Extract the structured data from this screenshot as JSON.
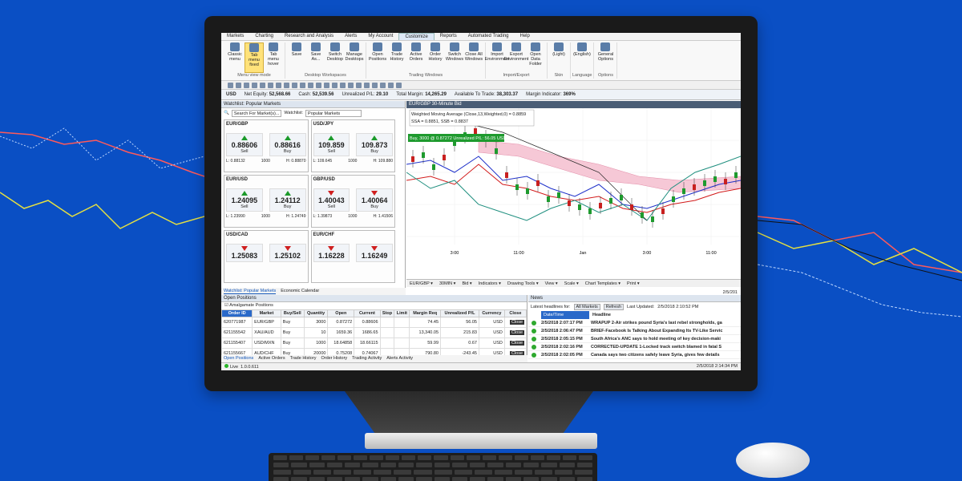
{
  "menu": [
    "Markets",
    "Charting",
    "Research and Analysis",
    "Alerts",
    "My Account",
    "Customize",
    "Reports",
    "Automated Trading",
    "Help"
  ],
  "menu_active": "Customize",
  "ribbon": {
    "groups": [
      {
        "label": "Menu view mode",
        "buttons": [
          "Classic menu",
          "Tab menu fixed",
          "Tab menu hover"
        ],
        "selected": "Tab menu fixed"
      },
      {
        "label": "Desktop Workspaces",
        "buttons": [
          "Save",
          "Save As...",
          "Switch Desktop",
          "Manage Desktops"
        ]
      },
      {
        "label": "Trading Windows",
        "buttons": [
          "Open Positions",
          "Trade History",
          "Active Orders",
          "Order History",
          "Switch Windows",
          "Close All Windows"
        ]
      },
      {
        "label": "Import/Export",
        "buttons": [
          "Import Environment",
          "Export Environment",
          "Open Data Folder"
        ]
      },
      {
        "label": "Skin",
        "buttons": [
          "(Light)"
        ]
      },
      {
        "label": "Language",
        "buttons": [
          "(English)"
        ]
      },
      {
        "label": "Options",
        "buttons": [
          "General Options"
        ]
      }
    ]
  },
  "account": {
    "currency": "USD",
    "net_equity_label": "Net Equity:",
    "net_equity": "52,568.66",
    "cash_label": "Cash:",
    "cash": "52,539.56",
    "upl_label": "Unrealized P/L:",
    "upl": "29.10",
    "margin_label": "Total Margin:",
    "margin": "14,265.29",
    "avail_label": "Available To Trade:",
    "avail": "38,303.37",
    "mi_label": "Margin Indicator:",
    "mi": "369%"
  },
  "watchlist": {
    "title": "Watchlist: Popular Markets",
    "search": "Search For Market(s)...",
    "select_label": "Watchlist:",
    "select_value": "Popular Markets",
    "tiles": [
      {
        "name": "EUR/GBP",
        "sell": "0.88606",
        "buy": "0.88616",
        "spread": "1",
        "sell_dir": "up",
        "buy_dir": "up",
        "low": "L: 0.88132",
        "qty": "1000",
        "high": "H: 0.88870",
        "sell_label": "Sell",
        "buy_label": "Buy"
      },
      {
        "name": "USD/JPY",
        "sell": "109.859",
        "buy": "109.873",
        "spread": "1.4",
        "sell_dir": "up",
        "buy_dir": "up",
        "low": "L: 109.645",
        "qty": "1000",
        "high": "H: 109.880",
        "sell_label": "Sell",
        "buy_label": "Buy"
      },
      {
        "name": "EUR/USD",
        "sell": "1.24095",
        "buy": "1.24112",
        "spread": "1.7",
        "sell_dir": "up",
        "buy_dir": "up",
        "low": "L: 1.23990",
        "qty": "1000",
        "high": "H: 1.24749",
        "sell_label": "Sell",
        "buy_label": "Buy"
      },
      {
        "name": "GBP/USD",
        "sell": "1.40043",
        "buy": "1.40064",
        "spread": "2.1",
        "sell_dir": "dn",
        "buy_dir": "dn",
        "low": "L: 1.39873",
        "qty": "1000",
        "high": "H: 1.41506",
        "sell_label": "Sell",
        "buy_label": "Buy"
      },
      {
        "name": "USD/CAD",
        "sell": "1.25083",
        "buy": "1.25102",
        "spread": "",
        "sell_dir": "dn",
        "buy_dir": "dn",
        "low": "",
        "qty": "",
        "high": "",
        "sell_label": "",
        "buy_label": ""
      },
      {
        "name": "EUR/CHF",
        "sell": "1.16228",
        "buy": "1.16249",
        "spread": "",
        "sell_dir": "dn",
        "buy_dir": "dn",
        "low": "",
        "qty": "",
        "high": "",
        "sell_label": "",
        "buy_label": ""
      }
    ],
    "tabs": [
      "Watchlist: Popular Markets",
      "Economic Calendar"
    ]
  },
  "chart": {
    "title": "EUR/GBP 30-Minute Bid",
    "legend1": "Weighted Moving Average (Close,13,Weighted,0) = 0.8859",
    "legend2": "SSA = 0.8851, SSB = 0.8837",
    "position": "Buy, 3000 @ 0.87272 Unrealized P/L: 56.05 USD",
    "x_ticks": [
      "3:00",
      "11:00",
      "Jan",
      "3:00",
      "11:00"
    ],
    "toolbar": [
      "EUR/GBP",
      "30MIN",
      "Bid",
      "Indicators",
      "Drawing Tools",
      "View",
      "Scale",
      "Chart Templates",
      "Print"
    ],
    "date": "2/5/201"
  },
  "positions": {
    "title": "Open Positions",
    "amalgamate": "Amalgamate Positions",
    "headers": [
      "Order ID",
      "Market",
      "Buy/Sell",
      "Quantity",
      "Open",
      "Current",
      "Stop",
      "Limit",
      "Margin Req",
      "Unrealized P/L",
      "Currency",
      "Close"
    ],
    "rows": [
      [
        "620771987",
        "EUR/GBP",
        "Buy",
        "3000",
        "0.87272",
        "0.88606",
        "",
        "",
        "74.45",
        "56.05",
        "USD",
        "Close"
      ],
      [
        "621155542",
        "XAU/AUD",
        "Buy",
        "10",
        "1659.36",
        "1686.65",
        "",
        "",
        "13,340.05",
        "215.83",
        "USD",
        "Close"
      ],
      [
        "621155407",
        "USD/MXN",
        "Buy",
        "1000",
        "18.64858",
        "18.66115",
        "",
        "",
        "59.99",
        "0.67",
        "USD",
        "Close"
      ],
      [
        "621155667",
        "AUD/CHF",
        "Buy",
        "20000",
        "0.75208",
        "0.74067",
        "",
        "",
        "790.80",
        "-243.45",
        "USD",
        "Close"
      ]
    ],
    "tabs": [
      "Open Positions",
      "Active Orders",
      "Trade History",
      "Order History",
      "Trading Activity",
      "Alerts Activity"
    ]
  },
  "news": {
    "title": "News",
    "latest_label": "Latest headlines for:",
    "filter": "All Markets",
    "refresh": "Refresh",
    "updated_label": "Last Updated:",
    "updated": "2/5/2018 2:10:52 PM",
    "col_date": "Date/Time",
    "col_headline": "Headline",
    "items": [
      {
        "time": "2/5/2018 2:07:17 PM",
        "headline": "WRAPUP 2-Air strikes pound Syria's last rebel strongholds, ga"
      },
      {
        "time": "2/5/2018 2:06:47 PM",
        "headline": "BRIEF-Facebook Is Talking About Expanding Its TV-Like Servic"
      },
      {
        "time": "2/5/2018 2:05:15 PM",
        "headline": "South Africa's ANC says to hold meeting of key decision-maki"
      },
      {
        "time": "2/5/2018 2:02:16 PM",
        "headline": "CORRECTED-UPDATE 1-Locked track switch blamed in fatal S"
      },
      {
        "time": "2/5/2018 2:02:05 PM",
        "headline": "Canada says two citizens safely leave Syria, gives few details"
      }
    ]
  },
  "status": {
    "live": "Live",
    "version": "1.0.0.611",
    "datetime": "2/5/2018 2:14:34 PM"
  }
}
